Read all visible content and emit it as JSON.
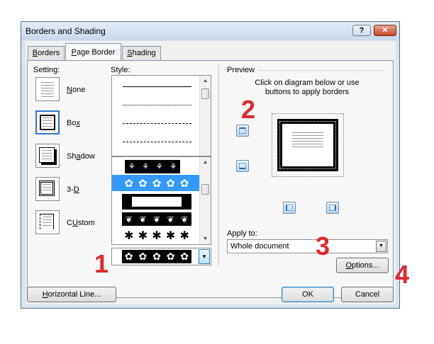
{
  "window": {
    "title": "Borders and Shading",
    "help_label": "?",
    "close_label": "✕"
  },
  "tabs": [
    {
      "label": "Borders",
      "mnemonic": "B",
      "rest": "orders"
    },
    {
      "label": "Page Border",
      "pre": "",
      "mnemonic": "P",
      "rest": "age Border"
    },
    {
      "label": "Shading",
      "mnemonic": "S",
      "rest": "hading"
    }
  ],
  "setting": {
    "label": "Setting:",
    "options": [
      {
        "label": "None",
        "mnemonic": "N",
        "rest": "one"
      },
      {
        "label": "Box",
        "mnemonic": "x",
        "pre": "Bo",
        "rest": ""
      },
      {
        "label": "Shadow",
        "pre": "Sh",
        "mnemonic": "a",
        "rest": "dow"
      },
      {
        "label": "3-D",
        "pre": "3-",
        "mnemonic": "D",
        "rest": ""
      },
      {
        "label": "Custom",
        "mnemonic": "U",
        "pre": "C",
        "rest": "stom"
      }
    ],
    "selected": "Box"
  },
  "style": {
    "label": "Style:",
    "lines": [
      "solid",
      "dotted",
      "dashed",
      "dash-dot"
    ]
  },
  "art": {
    "glyphs": [
      "✿",
      "✿",
      "✿",
      "✿",
      "✿"
    ],
    "star_glyphs": [
      "✱",
      "✱",
      "✱",
      "✱",
      "✱"
    ],
    "dropdown_glyphs": [
      "✿",
      "✿",
      "✿",
      "✿",
      "✿"
    ]
  },
  "preview": {
    "label": "Preview",
    "instruction": "Click on diagram below or use buttons to apply borders"
  },
  "apply_to": {
    "label": "Apply to:",
    "value": "Whole document"
  },
  "buttons": {
    "options": "Options...",
    "options_mnemonic": "O",
    "options_rest": "ptions...",
    "horizontal_line": "Horizontal Line...",
    "hl_mnemonic": "H",
    "hl_rest": "orizontal Line...",
    "ok": "OK",
    "cancel": "Cancel"
  },
  "annotations": [
    "1",
    "2",
    "3",
    "4"
  ],
  "colors": {
    "annotation": "#e0282e",
    "selection": "#3399ff"
  }
}
